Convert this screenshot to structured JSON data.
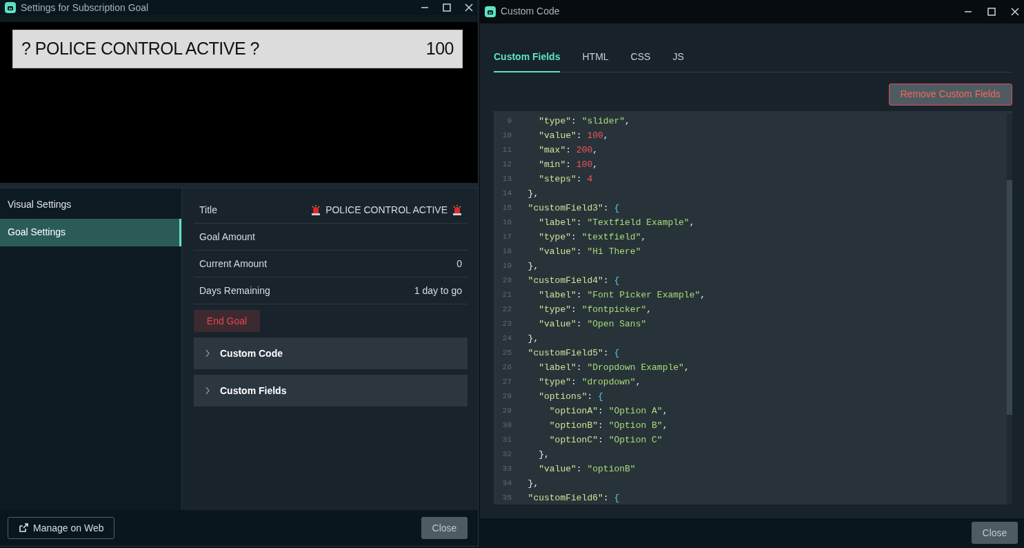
{
  "settings_window": {
    "title": "Settings for Subscription Goal",
    "preview": {
      "label": "? POLICE CONTROL ACTIVE ?",
      "amount": "100"
    },
    "sidebar": {
      "items": [
        {
          "label": "Visual Settings",
          "selected": false
        },
        {
          "label": "Goal Settings",
          "selected": true
        }
      ]
    },
    "fields": [
      {
        "label": "Title",
        "value": "POLICE CONTROL ACTIVE",
        "kind": "siren"
      },
      {
        "label": "Goal Amount",
        "kind": "plain"
      },
      {
        "label": "Current Amount",
        "value": "0",
        "kind": "plain"
      },
      {
        "label": "Days Remaining",
        "value": "1 day to go",
        "kind": "plain"
      }
    ],
    "end_button": "End Goal",
    "sections": [
      {
        "label": "Custom Code",
        "expanded": false
      },
      {
        "label": "Custom Fields",
        "expanded": false
      }
    ],
    "footer": {
      "manage_button": "Manage on Web",
      "close_button": "Close"
    }
  },
  "code_window": {
    "title": "Custom Code",
    "tabs": [
      {
        "label": "Custom Fields",
        "selected": true
      },
      {
        "label": "HTML",
        "selected": false
      },
      {
        "label": "CSS",
        "selected": false
      },
      {
        "label": "JS",
        "selected": false
      }
    ],
    "remove_button": "Remove Custom Fields",
    "code_lines": [
      {
        "number": "9",
        "code": "    \"type\": \"slider\","
      },
      {
        "number": "10",
        "code": "    \"value\": 100,"
      },
      {
        "number": "11",
        "code": "    \"max\": 200,"
      },
      {
        "number": "12",
        "code": "    \"min\": 100,"
      },
      {
        "number": "13",
        "code": "    \"steps\": 4"
      },
      {
        "number": "14",
        "code": "  },"
      },
      {
        "number": "15",
        "code": "  \"customField3\": {"
      },
      {
        "number": "16",
        "code": "    \"label\": \"Textfield Example\","
      },
      {
        "number": "17",
        "code": "    \"type\": \"textfield\","
      },
      {
        "number": "18",
        "code": "    \"value\": \"Hi There\""
      },
      {
        "number": "19",
        "code": "  },"
      },
      {
        "number": "20",
        "code": "  \"customField4\": {"
      },
      {
        "number": "21",
        "code": "    \"label\": \"Font Picker Example\","
      },
      {
        "number": "22",
        "code": "    \"type\": \"fontpicker\","
      },
      {
        "number": "23",
        "code": "    \"value\": \"Open Sans\""
      },
      {
        "number": "24",
        "code": "  },"
      },
      {
        "number": "25",
        "code": "  \"customField5\": {"
      },
      {
        "number": "26",
        "code": "    \"label\": \"Dropdown Example\","
      },
      {
        "number": "27",
        "code": "    \"type\": \"dropdown\","
      },
      {
        "number": "28",
        "code": "    \"options\": {"
      },
      {
        "number": "29",
        "code": "      \"optionA\": \"Option A\","
      },
      {
        "number": "30",
        "code": "      \"optionB\": \"Option B\","
      },
      {
        "number": "31",
        "code": "      \"optionC\": \"Option C\""
      },
      {
        "number": "32",
        "code": "    },"
      },
      {
        "number": "33",
        "code": "    \"value\": \"optionB\""
      },
      {
        "number": "34",
        "code": "  },"
      },
      {
        "number": "35",
        "code": "  \"customField6\": {"
      }
    ],
    "close_button": "Close"
  }
}
